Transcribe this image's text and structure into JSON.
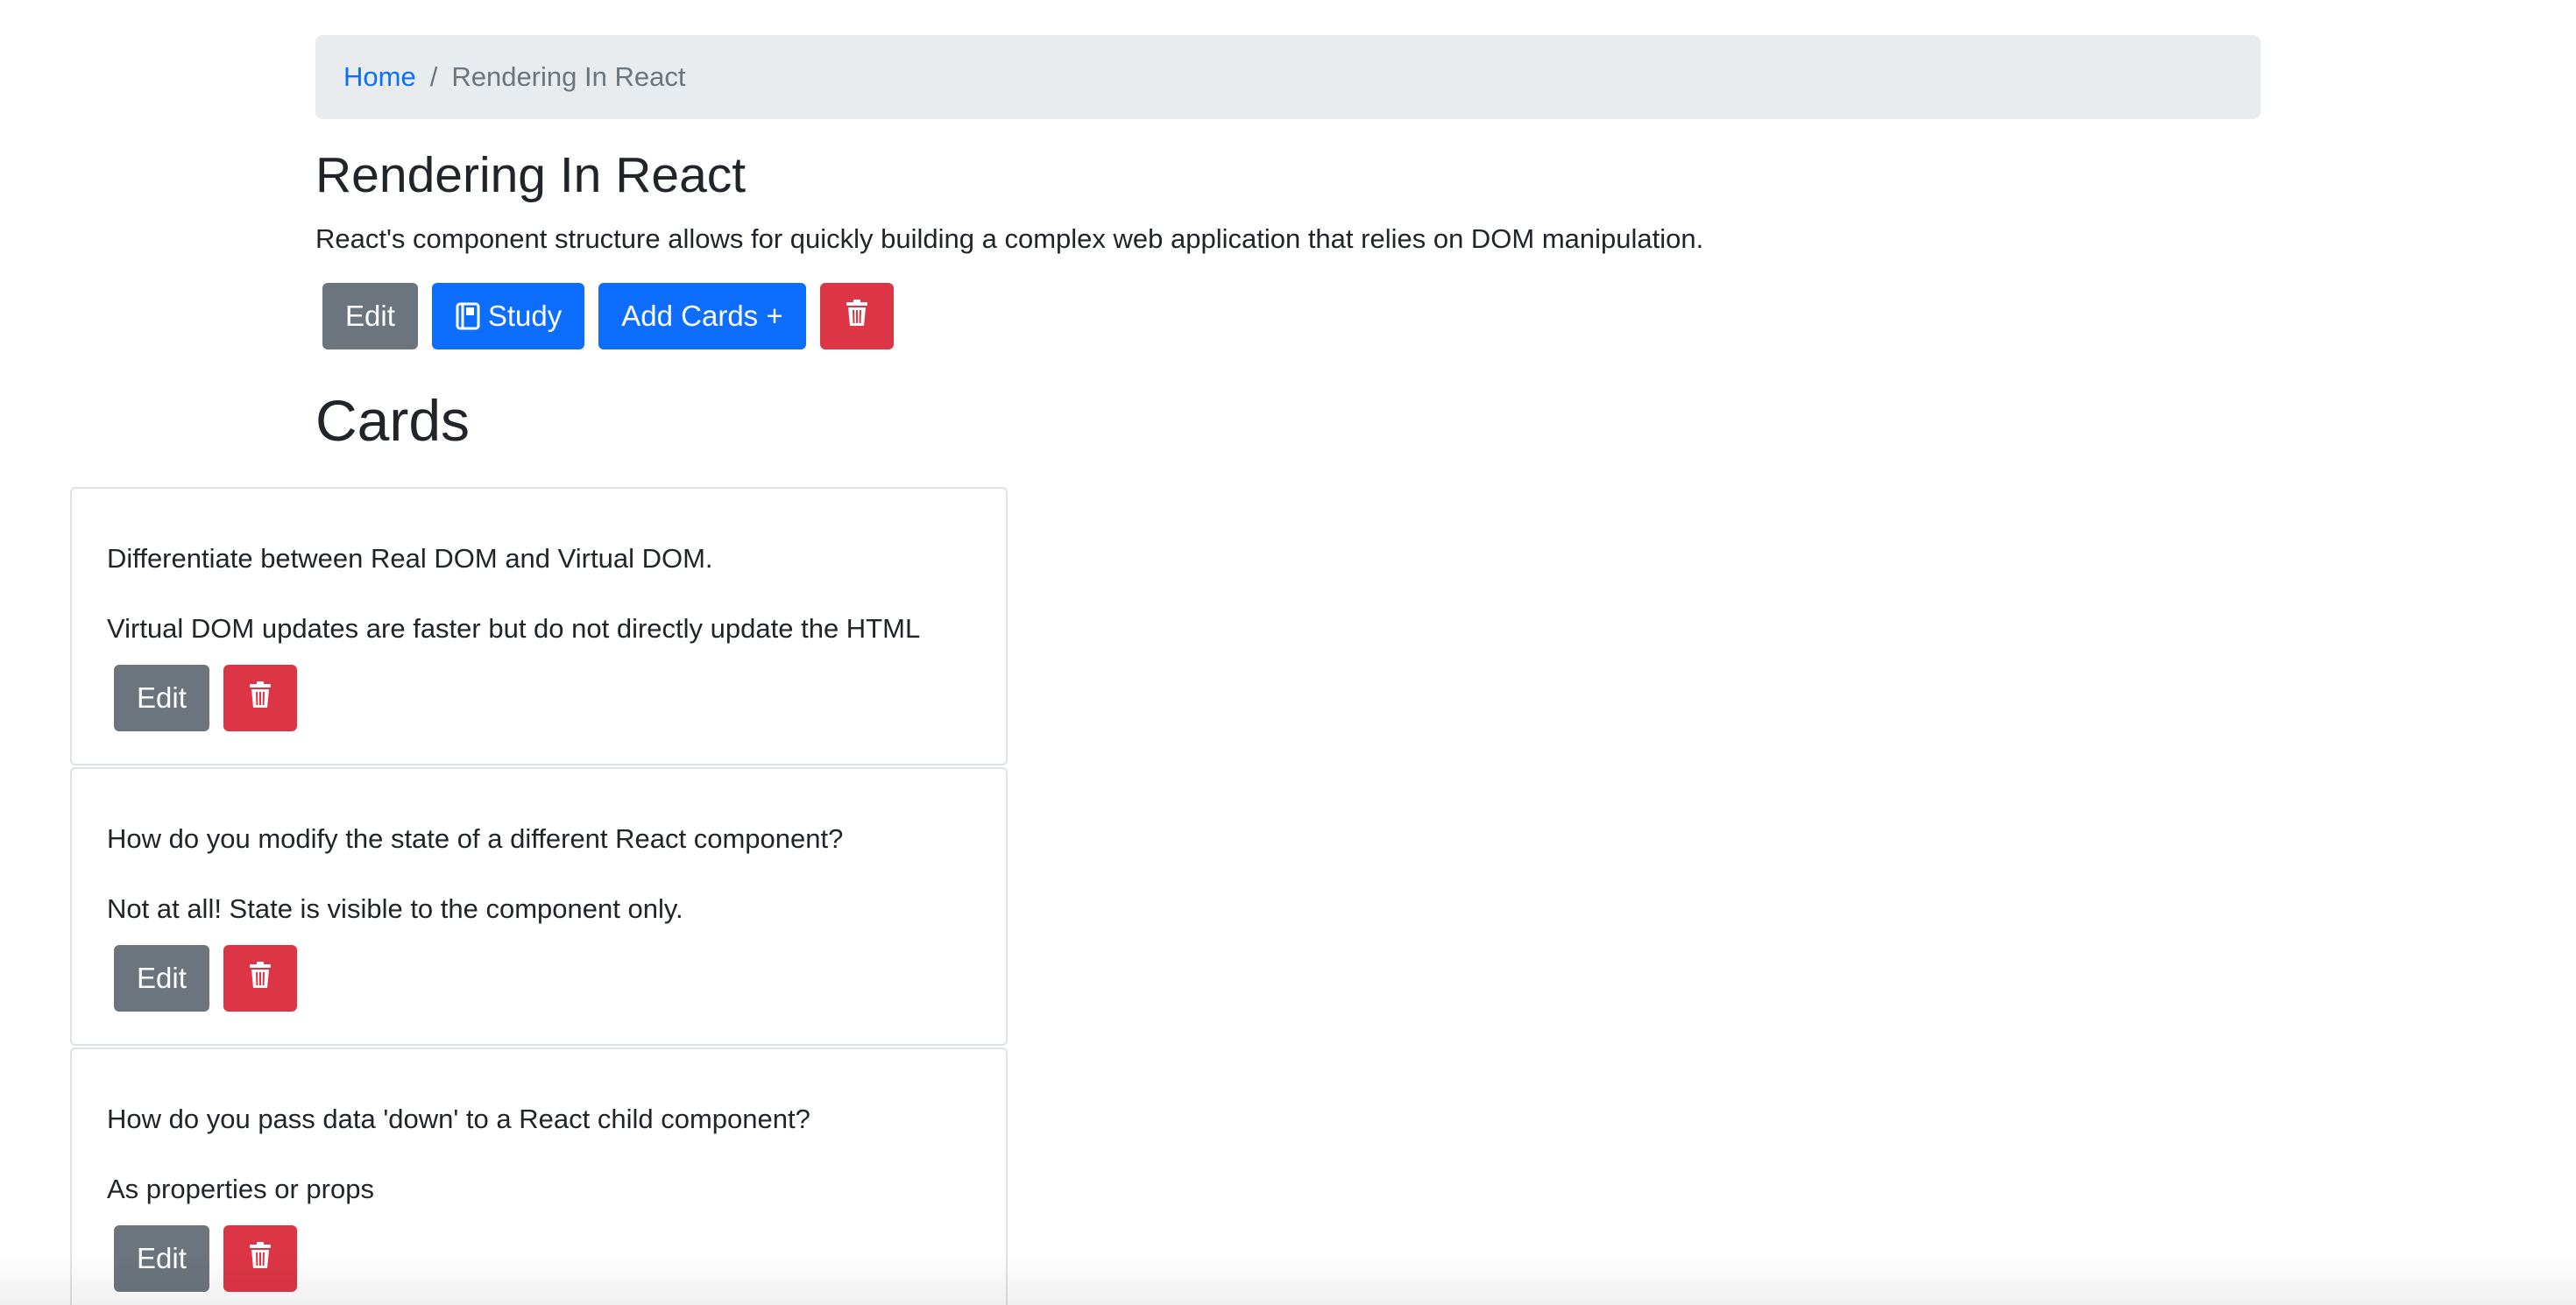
{
  "breadcrumb": {
    "home": "Home",
    "separator": "/",
    "current": "Rendering In React"
  },
  "deck": {
    "title": "Rendering In React",
    "description": "React's component structure allows for quickly building a complex web application that relies on DOM manipulation.",
    "edit_label": "Edit",
    "study_label": "Study",
    "add_cards_label": "Add Cards +",
    "delete_icon": "trash-icon",
    "study_icon": "book-icon"
  },
  "cards_heading": "Cards",
  "cards": [
    {
      "front": "Differentiate between Real DOM and Virtual DOM.",
      "back": "Virtual DOM updates are faster but do not directly update the HTML",
      "edit_label": "Edit"
    },
    {
      "front": "How do you modify the state of a different React component?",
      "back": "Not at all! State is visible to the component only.",
      "edit_label": "Edit"
    },
    {
      "front": "How do you pass data 'down' to a React child component?",
      "back": "As properties or props",
      "edit_label": "Edit"
    }
  ],
  "colors": {
    "primary": "#0d6efd",
    "secondary": "#6c757d",
    "danger": "#dc3545",
    "breadcrumb_bg": "#e9ecef"
  }
}
